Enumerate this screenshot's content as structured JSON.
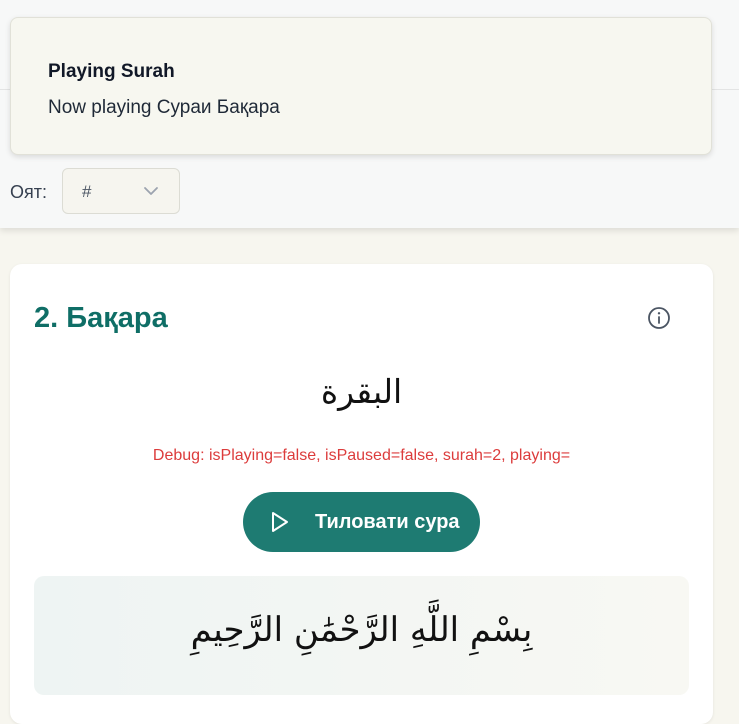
{
  "toast": {
    "title": "Playing Surah",
    "message": "Now playing Сураи Бақара"
  },
  "ayah_selector": {
    "label": "Оят:",
    "value": "#"
  },
  "surah_card": {
    "title": "2. Бақара",
    "arabic_name": "البقرة",
    "debug": "Debug: isPlaying=false, isPaused=false, surah=2, playing=",
    "play_button_label": "Тиловати сура",
    "bismillah": "بِسْمِ اللَّهِ الرَّحْمَٰنِ الرَّحِيمِ"
  },
  "colors": {
    "accent": "#1e7b72",
    "title": "#0f6e66",
    "debug": "#dc3c3c"
  },
  "icons": {
    "select_chevron": "chevron-down-icon",
    "info": "info-icon",
    "play": "play-icon"
  }
}
